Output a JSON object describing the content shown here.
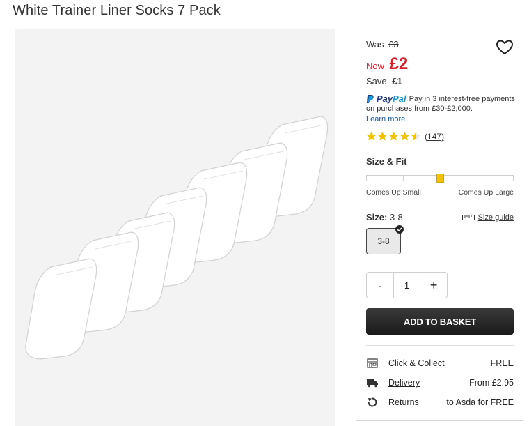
{
  "product": {
    "title": "White Trainer Liner Socks 7 Pack"
  },
  "pricing": {
    "was_label": "Was",
    "was_price": "£3",
    "now_label": "Now",
    "now_price": "£2",
    "save_label": "Save",
    "save_amount": "£1"
  },
  "paypal": {
    "brand_pay": "Pay",
    "brand_pal": "Pal",
    "text": "Pay in 3 interest-free payments on purchases from £30-£2,000.",
    "learn_more": "Learn more"
  },
  "rating": {
    "stars": 4.5,
    "max": 5,
    "count": "(147)"
  },
  "size_fit": {
    "heading": "Size & Fit",
    "fit_value": 0.5,
    "low_label": "Comes Up Small",
    "high_label": "Comes Up Large"
  },
  "size": {
    "label": "Size:",
    "selected": "3-8",
    "guide_label": "Size guide",
    "options": [
      "3-8"
    ]
  },
  "quantity": {
    "minus": "-",
    "value": "1",
    "plus": "+"
  },
  "add_to_basket": "ADD TO BASKET",
  "services": [
    {
      "label": "Click & Collect",
      "value": "FREE",
      "icon": "store-icon"
    },
    {
      "label": "Delivery",
      "value": "From £2.95",
      "icon": "truck-icon"
    },
    {
      "label": "Returns",
      "value": "to Asda for FREE",
      "icon": "return-icon"
    }
  ],
  "colors": {
    "price_red": "#d4242b",
    "star_gold": "#f2c200",
    "button_dark": "#222222",
    "link_blue": "#0a5ab5"
  }
}
